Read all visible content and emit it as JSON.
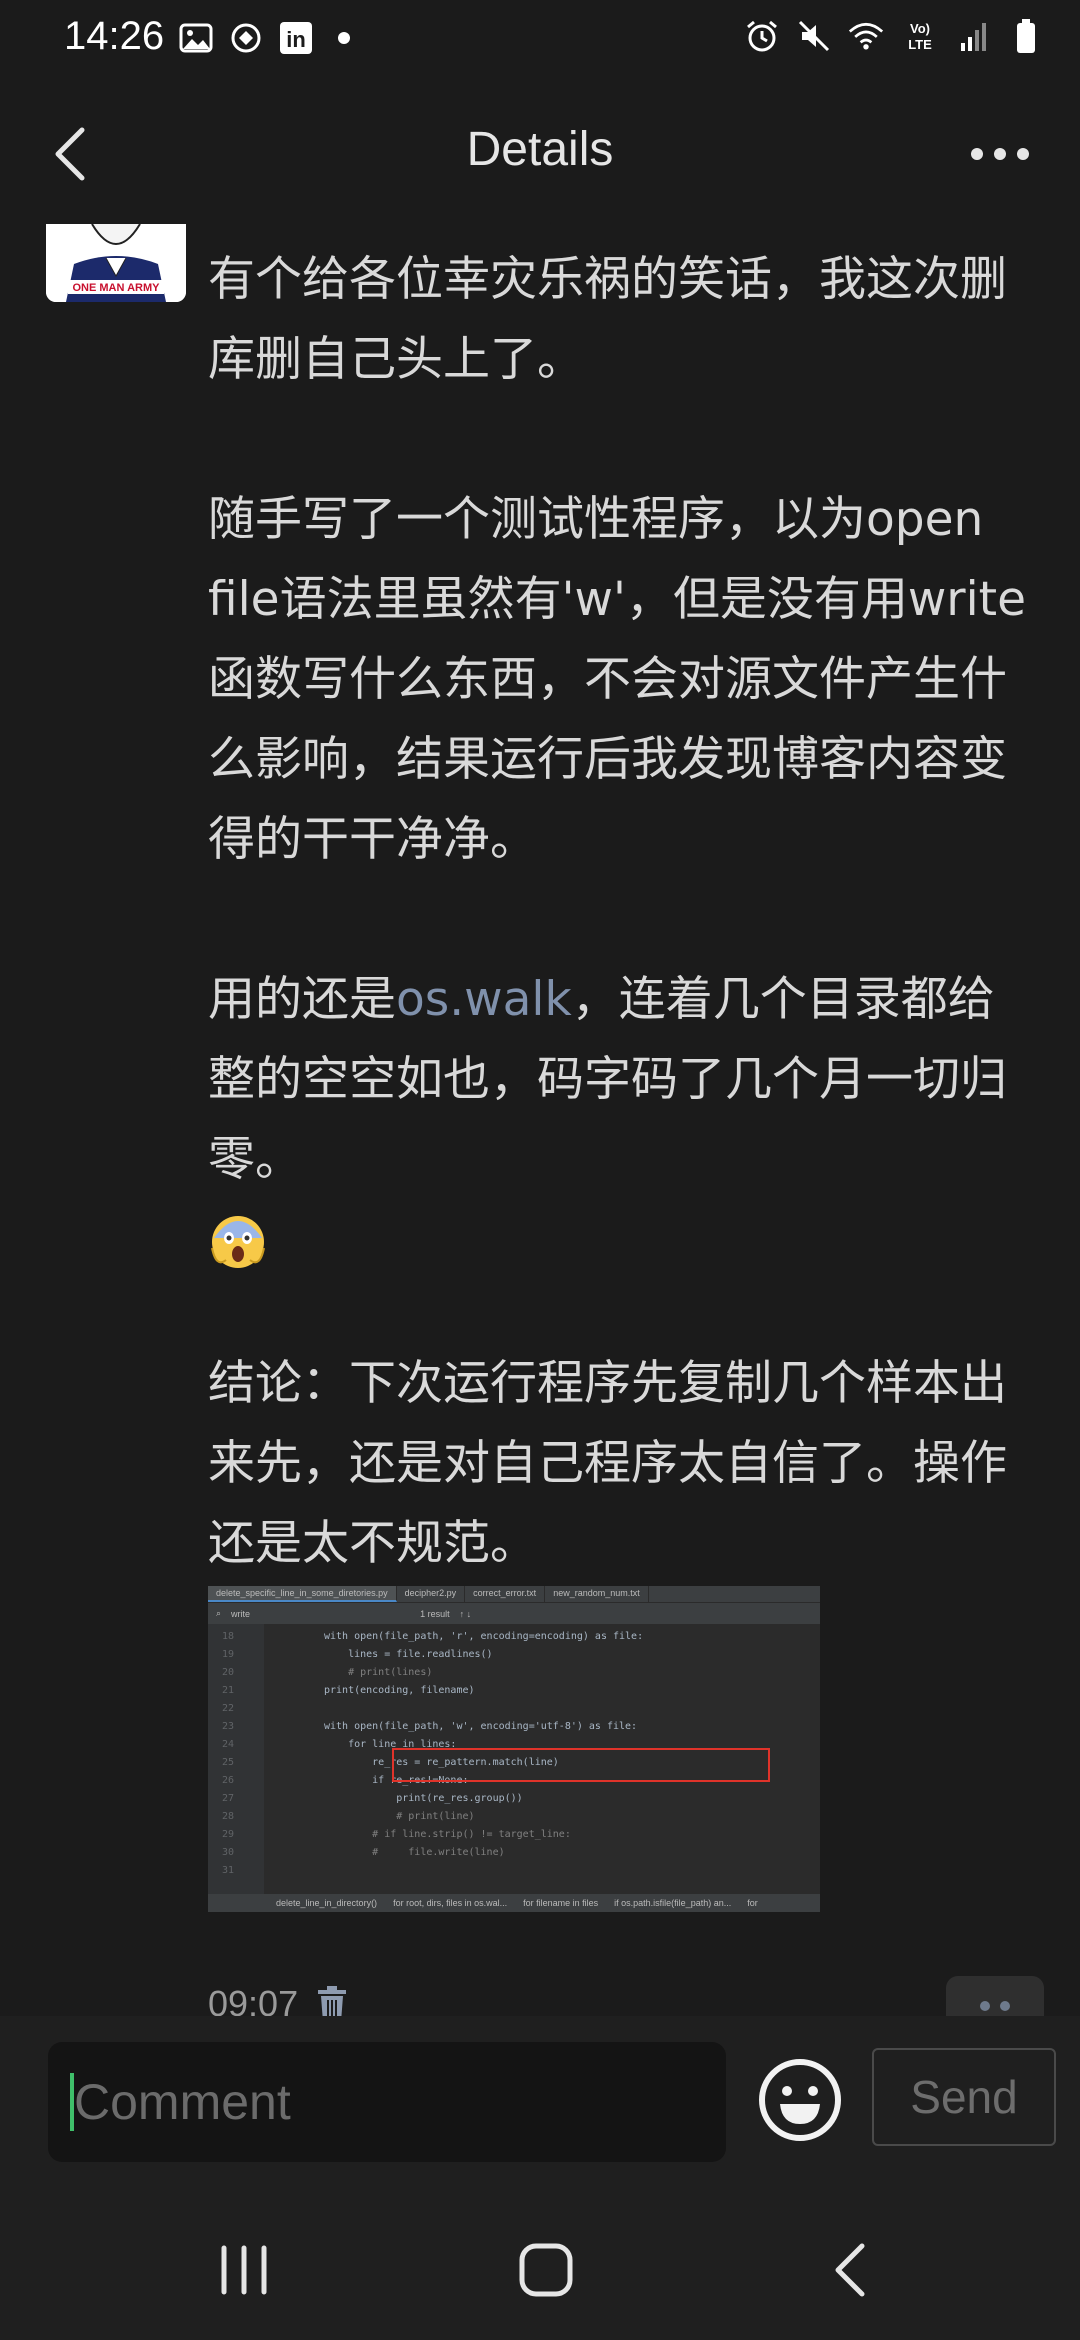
{
  "status_bar": {
    "time": "14:26",
    "left_icons": [
      "gallery-icon",
      "sync-icon",
      "linkedin-icon",
      "notification-dot-icon"
    ],
    "right_icons": [
      "alarm-icon",
      "mute-icon",
      "wifi-icon",
      "volte-icon",
      "signal-icon",
      "battery-icon"
    ],
    "volte_label": "Vo) LTE",
    "linkedin_label": "in"
  },
  "header": {
    "title": "Details",
    "back_icon": "chevron-left-icon",
    "more_icon": "more-horizontal-icon"
  },
  "post": {
    "avatar_caption": "ONE MAN ARMY",
    "paragraphs": [
      "有个给各位幸灾乐祸的笑话，我这次删库删自己头上了。",
      "随手写了一个测试性程序，以为open file语法里虽然有'w'，但是没有用write函数写什么东西，不会对源文件产生什么影响，结果运行后我发现博客内容变得的干干净净。"
    ],
    "p3_before": "用的还是",
    "p3_link": "os.walk",
    "p3_after": "，连着几个目录都给整的空空如也，码字码了几个月一切归零。",
    "emoji": "scream-emoji",
    "conclusion": "结论：下次运行程序先复制几个样本出来先，还是对自己程序太自信了。操作还是太不规范。",
    "timestamp": "09:07",
    "delete_icon": "trash-icon",
    "reaction_icon": "more-dots-icon"
  },
  "screenshot": {
    "tabs": [
      "delete_specific_line_in_some_diretories.py",
      "decipher2.py",
      "correct_error.txt",
      "new_random_num.txt"
    ],
    "find_text": "write",
    "find_result": "1 result",
    "lines": [
      {
        "no": "18",
        "code": "with open(file_path, 'r', encoding=encoding) as file:"
      },
      {
        "no": "19",
        "code": "    lines = file.readlines()"
      },
      {
        "no": "20",
        "code": "    # print(lines)"
      },
      {
        "no": "21",
        "code": "print(encoding, filename)"
      },
      {
        "no": "22",
        "code": ""
      },
      {
        "no": "23",
        "code": "with open(file_path, 'w', encoding='utf-8') as file:"
      },
      {
        "no": "24",
        "code": "    for line in lines:"
      },
      {
        "no": "25",
        "code": "        re_res = re_pattern.match(line)"
      },
      {
        "no": "26",
        "code": "        if re_res!=None:"
      },
      {
        "no": "27",
        "code": "            print(re_res.group())"
      },
      {
        "no": "28",
        "code": "            # print(line)"
      },
      {
        "no": "29",
        "code": "        # if line.strip() != target_line:"
      },
      {
        "no": "30",
        "code": "        #     file.write(line)"
      },
      {
        "no": "31",
        "code": ""
      }
    ],
    "breadcrumbs": [
      "delete_line_in_directory()",
      "for root, dirs, files in os.wal...",
      "for filename in files",
      "if os.path.isfile(file_path) an...",
      "for"
    ]
  },
  "comment_bar": {
    "placeholder": "Comment",
    "send_label": "Send",
    "emoji_icon": "smiley-icon"
  },
  "nav_bar": {
    "recent_icon": "recent-apps-icon",
    "home_icon": "home-icon",
    "back_icon": "back-icon"
  }
}
